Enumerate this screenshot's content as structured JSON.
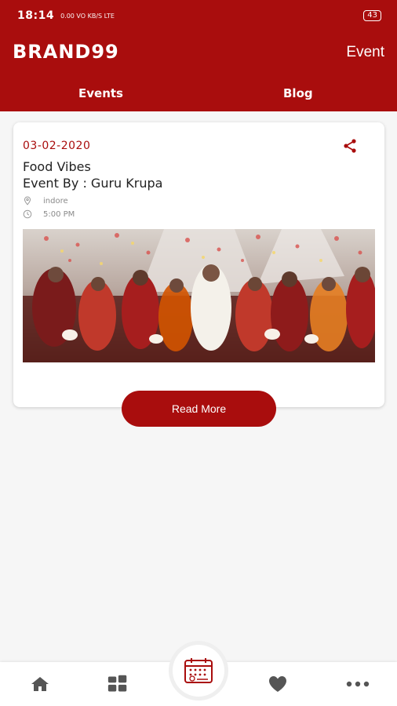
{
  "status_bar": {
    "time": "18:14",
    "network": "0.00 VO KB/S LTE",
    "battery": "43"
  },
  "header": {
    "brand": "BRAND99",
    "title": "Event"
  },
  "tabs": [
    {
      "label": "Events"
    },
    {
      "label": "Blog"
    }
  ],
  "event_card": {
    "date": "03-02-2020",
    "title_line1": "Food Vibes",
    "title_line2": "Event By : Guru Krupa",
    "location": "indore",
    "time": "5:00 PM",
    "action_label": "Read More"
  },
  "bottom_nav": {
    "items": [
      {
        "icon": "home-icon"
      },
      {
        "icon": "grid-icon"
      },
      {
        "icon": "calendar-icon"
      },
      {
        "icon": "heart-icon"
      },
      {
        "icon": "more-icon"
      }
    ]
  },
  "colors": {
    "brand": "#a90d0d",
    "background": "#f6f6f6"
  }
}
